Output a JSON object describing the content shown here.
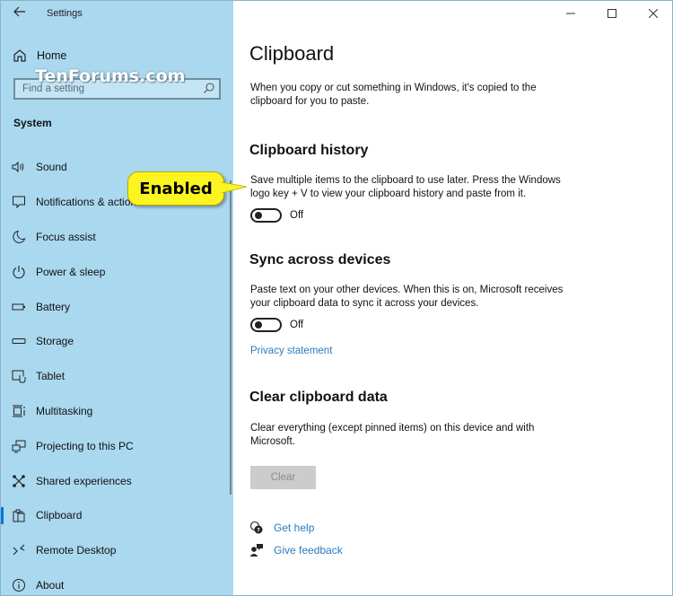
{
  "window": {
    "app_title": "Settings",
    "controls": [
      "minimize",
      "maximize",
      "close"
    ]
  },
  "watermark": "TenForums.com",
  "sidebar": {
    "home_label": "Home",
    "search": {
      "placeholder": "Find a setting",
      "value": ""
    },
    "section_title": "System",
    "items": [
      {
        "label": "Sound",
        "icon": "speaker-icon"
      },
      {
        "label": "Notifications & actions",
        "icon": "message-icon"
      },
      {
        "label": "Focus assist",
        "icon": "moon-icon"
      },
      {
        "label": "Power & sleep",
        "icon": "power-icon"
      },
      {
        "label": "Battery",
        "icon": "battery-icon"
      },
      {
        "label": "Storage",
        "icon": "storage-icon"
      },
      {
        "label": "Tablet",
        "icon": "tablet-icon"
      },
      {
        "label": "Multitasking",
        "icon": "multitasking-icon"
      },
      {
        "label": "Projecting to this PC",
        "icon": "projecting-icon"
      },
      {
        "label": "Shared experiences",
        "icon": "shared-experiences-icon"
      },
      {
        "label": "Clipboard",
        "icon": "clipboard-icon",
        "active": true
      },
      {
        "label": "Remote Desktop",
        "icon": "remote-desktop-icon"
      },
      {
        "label": "About",
        "icon": "info-icon"
      }
    ]
  },
  "callout": {
    "text": "Enabled",
    "color": "#fbf420"
  },
  "main": {
    "title": "Clipboard",
    "intro": "When you copy or cut something in Windows, it's copied to the clipboard for you to paste.",
    "history": {
      "heading": "Clipboard history",
      "description": "Save multiple items to the clipboard to use later. Press the Windows logo key + V to view your clipboard history and paste from it.",
      "toggle_state": "Off"
    },
    "sync": {
      "heading": "Sync across devices",
      "description": "Paste text on your other devices. When this is on, Microsoft receives your clipboard data to sync it across your devices.",
      "toggle_state": "Off",
      "privacy_link": "Privacy statement"
    },
    "clear": {
      "heading": "Clear clipboard data",
      "description": "Clear everything (except pinned items) on this device and with Microsoft.",
      "button_label": "Clear"
    },
    "help": {
      "get_help": "Get help",
      "give_feedback": "Give feedback"
    }
  },
  "colors": {
    "sidebar_bg": "#aad8ee",
    "accent": "#0078d7",
    "link": "#2a7bbf",
    "disabled_button": "#cccccc"
  }
}
